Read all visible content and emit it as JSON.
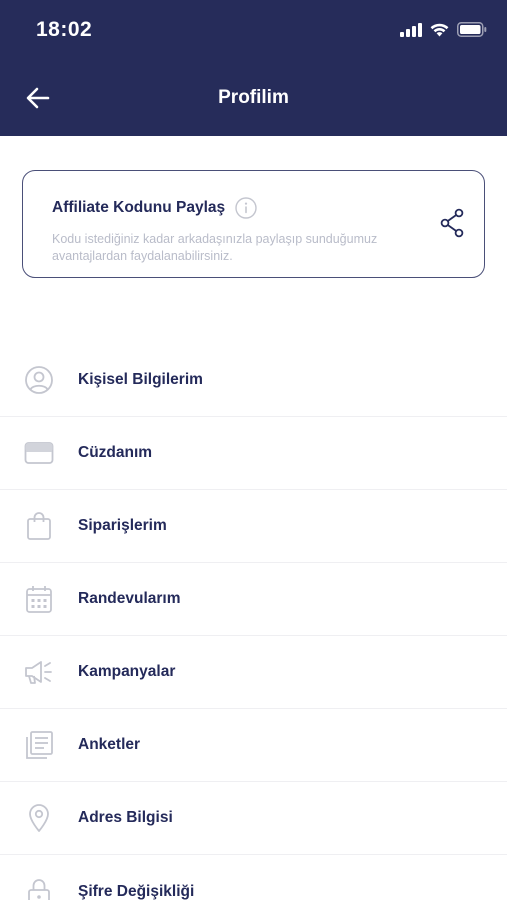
{
  "status_bar": {
    "time": "18:02"
  },
  "nav": {
    "title": "Profilim",
    "back_icon": "arrow-left-icon"
  },
  "affiliate": {
    "title": "Affiliate Kodunu Paylaş",
    "description": "Kodu istediğiniz kadar arkadaşınızla paylaşıp sunduğumuz avantajlardan faydalanabilirsiniz.",
    "info_icon": "info-icon",
    "share_icon": "share-icon"
  },
  "menu": {
    "items": [
      {
        "label": "Kişisel Bilgilerim",
        "icon": "user-circle-icon"
      },
      {
        "label": "Cüzdanım",
        "icon": "wallet-icon"
      },
      {
        "label": "Siparişlerim",
        "icon": "shopping-bag-icon"
      },
      {
        "label": "Randevularım",
        "icon": "calendar-icon"
      },
      {
        "label": "Kampanyalar",
        "icon": "megaphone-icon"
      },
      {
        "label": "Anketler",
        "icon": "document-list-icon"
      },
      {
        "label": "Adres Bilgisi",
        "icon": "location-pin-icon"
      },
      {
        "label": "Şifre Değişikliği",
        "icon": "lock-icon"
      }
    ]
  },
  "colors": {
    "header_bg": "#262c5a",
    "text_primary": "#242a5a",
    "text_muted": "#b9bcc9",
    "icon_muted": "#c4c6cf",
    "divider": "#efeff2"
  }
}
